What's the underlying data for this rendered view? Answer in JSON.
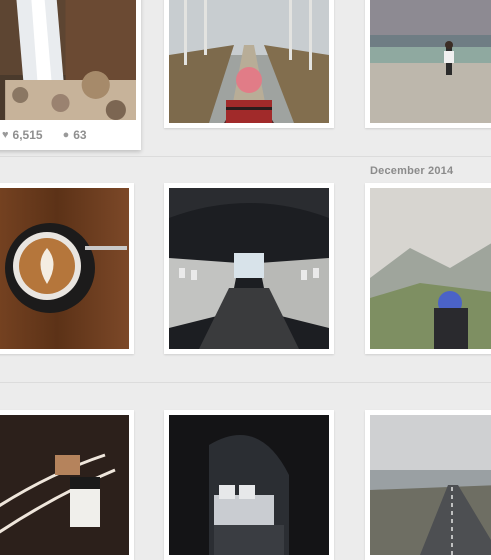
{
  "feed": {
    "date_label": "December 2014",
    "highlight_post": {
      "likes": "6,515",
      "comments": "63"
    },
    "photos": [
      {
        "subject": "waterfall"
      },
      {
        "subject": "tree-lined road, person with pink beanie"
      },
      {
        "subject": "person standing on rooftop overlooking city"
      },
      {
        "subject": "latte art coffee cup on wooden table"
      },
      {
        "subject": "abandoned airplane fuselage interior"
      },
      {
        "subject": "person with blue hair facing misty mountains"
      },
      {
        "subject": "camera with leather strap"
      },
      {
        "subject": "dark bedroom interior"
      },
      {
        "subject": "road through landscape"
      }
    ]
  }
}
